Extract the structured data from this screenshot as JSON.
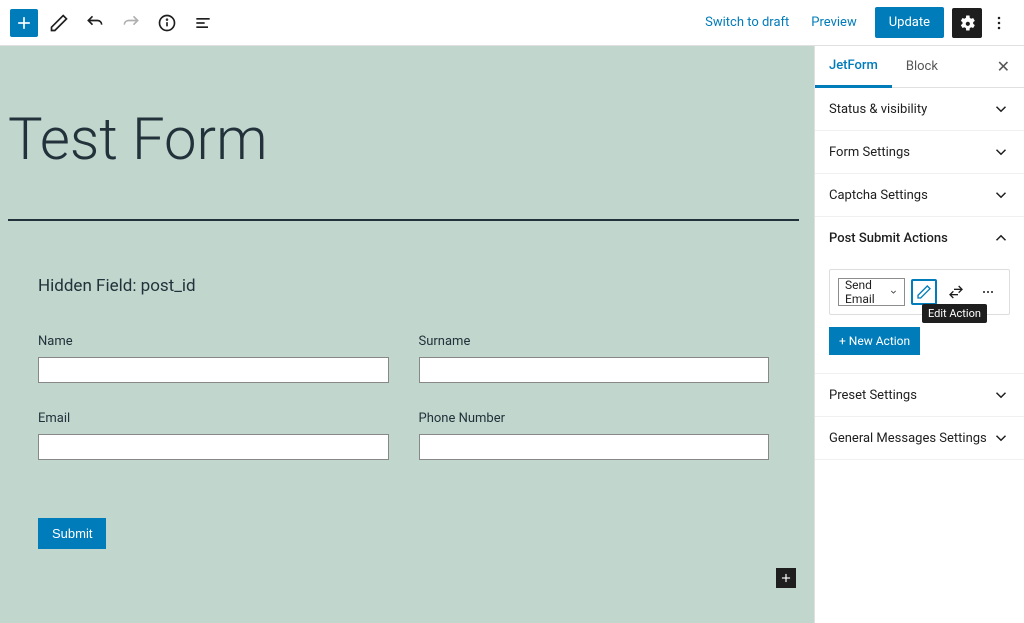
{
  "toolbar": {
    "switch_draft": "Switch to draft",
    "preview": "Preview",
    "update": "Update"
  },
  "canvas": {
    "title": "Test Form",
    "hidden_field": "Hidden Field: post_id",
    "fields": {
      "name": "Name",
      "surname": "Surname",
      "email": "Email",
      "phone": "Phone Number"
    },
    "submit": "Submit"
  },
  "sidebar": {
    "tabs": {
      "jetform": "JetForm",
      "block": "Block"
    },
    "panels": {
      "status": "Status & visibility",
      "form_settings": "Form Settings",
      "captcha": "Captcha Settings",
      "post_submit": "Post Submit Actions",
      "preset": "Preset Settings",
      "general_messages": "General Messages Settings"
    },
    "action": {
      "selected": "Send Email",
      "edit_tooltip": "Edit Action",
      "new_action": "+ New Action"
    }
  }
}
